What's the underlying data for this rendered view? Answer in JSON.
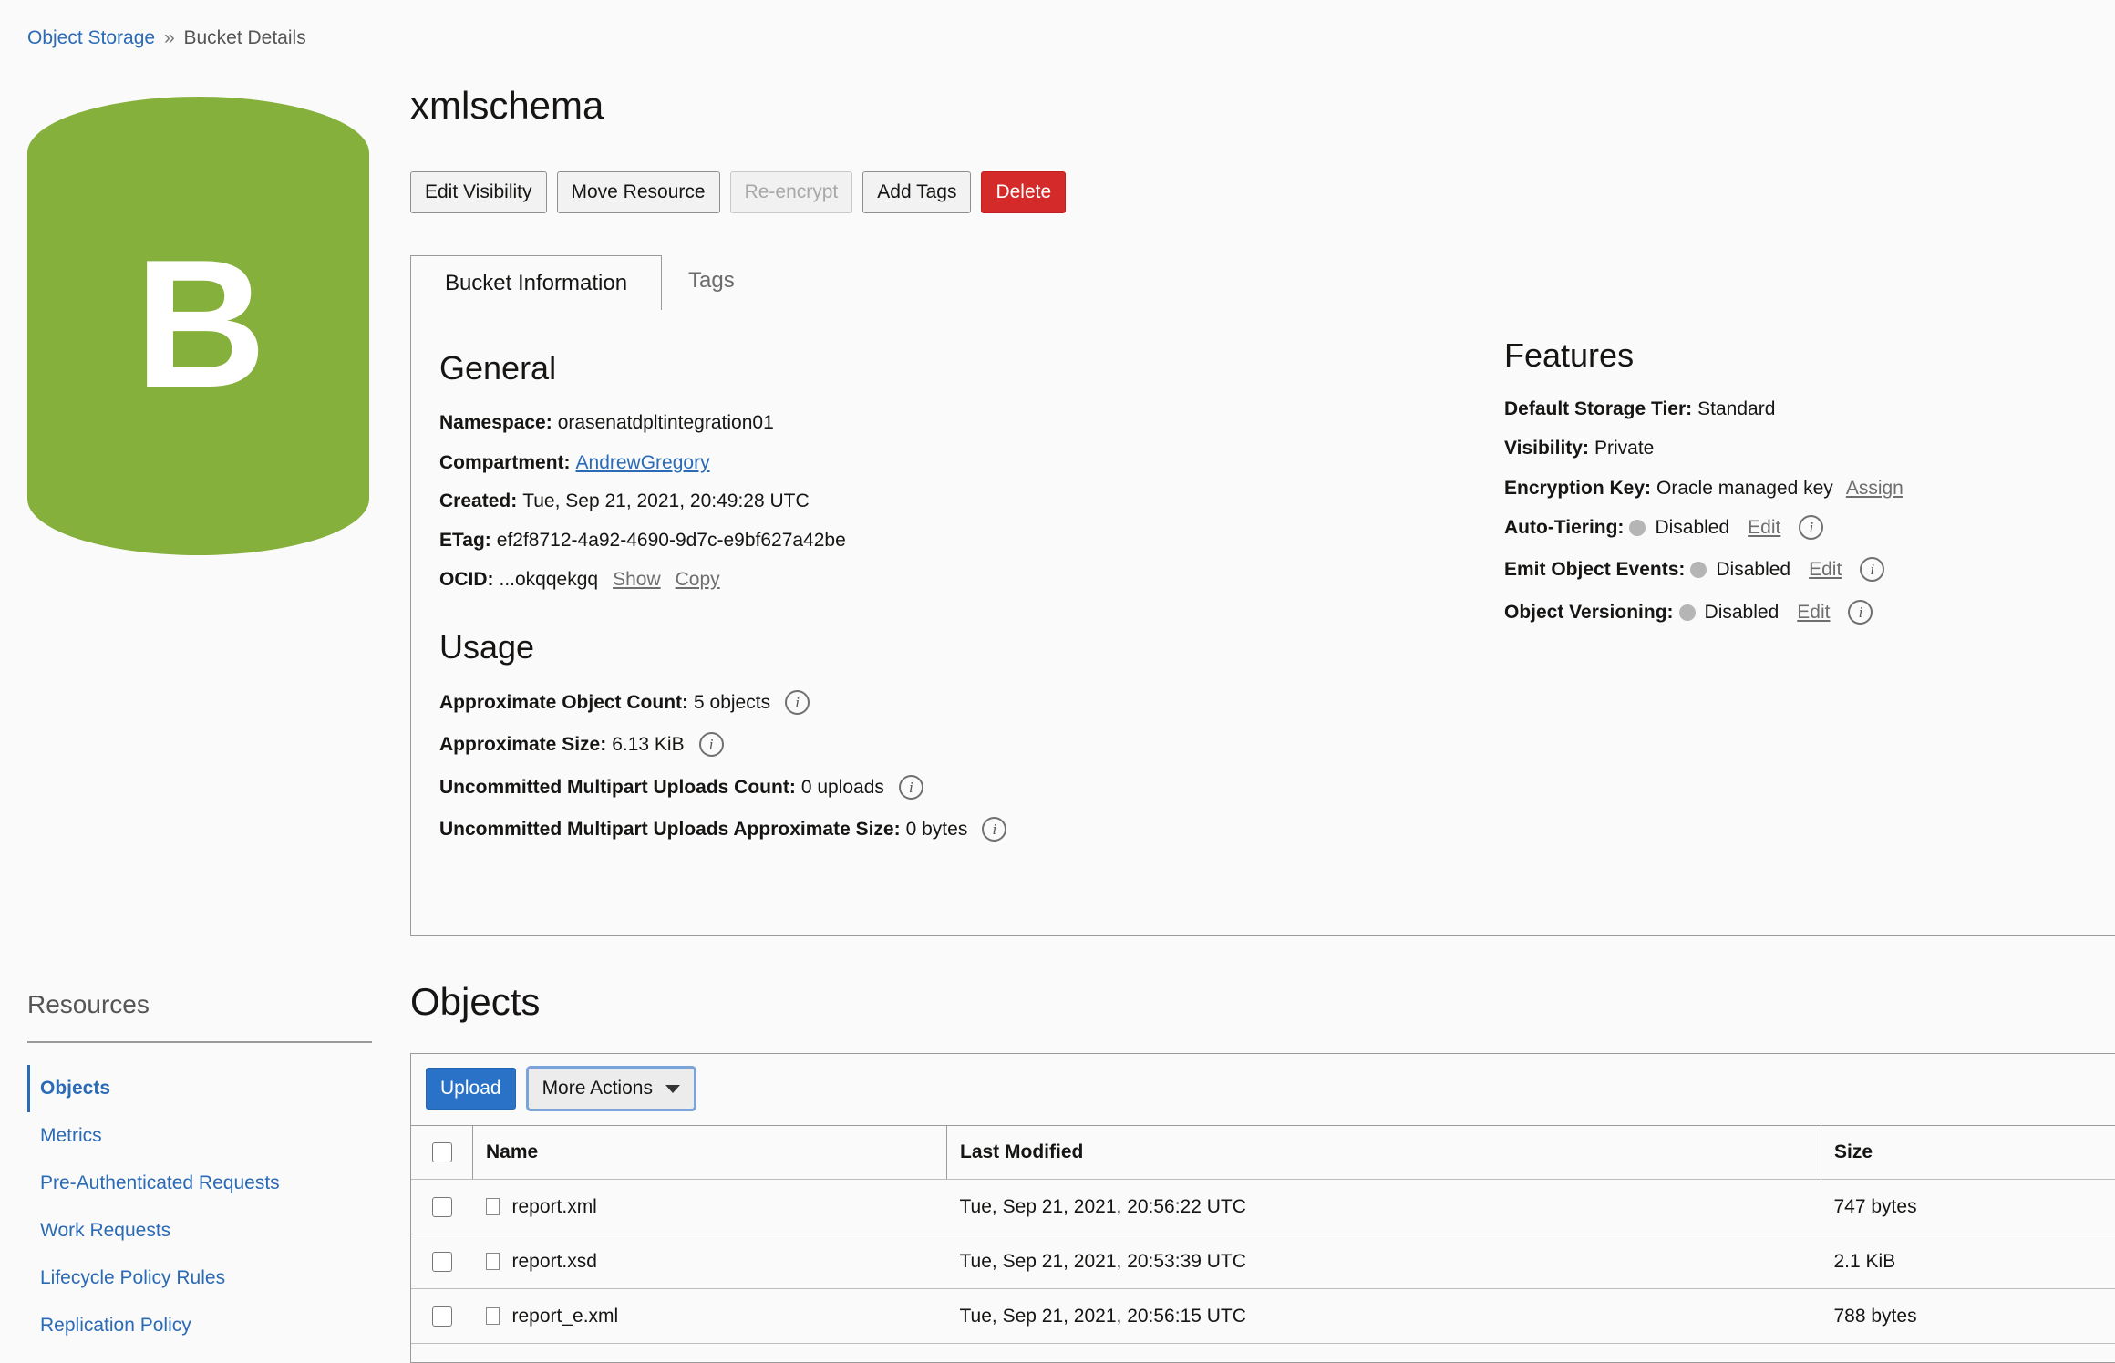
{
  "breadcrumb": {
    "root": "Object Storage",
    "separator": "»",
    "current": "Bucket Details"
  },
  "bucket_icon": {
    "letter": "B",
    "color": "#86b03c"
  },
  "title": "xmlschema",
  "actions": {
    "edit_visibility": "Edit Visibility",
    "move_resource": "Move Resource",
    "re_encrypt": "Re-encrypt",
    "add_tags": "Add Tags",
    "delete": "Delete"
  },
  "tabs": {
    "active": "Bucket Information",
    "inactive": "Tags"
  },
  "general": {
    "title": "General",
    "namespace_label": "Namespace:",
    "namespace": "orasenatdpltintegration01",
    "compartment_label": "Compartment:",
    "compartment": "AndrewGregory",
    "created_label": "Created:",
    "created": "Tue, Sep 21, 2021, 20:49:28 UTC",
    "etag_label": "ETag:",
    "etag": "ef2f8712-4a92-4690-9d7c-e9bf627a42be",
    "ocid_label": "OCID:",
    "ocid": "...okqqekgq",
    "show": "Show",
    "copy": "Copy"
  },
  "usage": {
    "title": "Usage",
    "object_count_label": "Approximate Object Count:",
    "object_count": "5 objects",
    "size_label": "Approximate Size:",
    "size": "6.13 KiB",
    "multipart_count_label": "Uncommitted Multipart Uploads Count:",
    "multipart_count": "0 uploads",
    "multipart_size_label": "Uncommitted Multipart Uploads Approximate Size:",
    "multipart_size": "0 bytes"
  },
  "features": {
    "title": "Features",
    "storage_tier_label": "Default Storage Tier:",
    "storage_tier": "Standard",
    "visibility_label": "Visibility:",
    "visibility": "Private",
    "encryption_label": "Encryption Key:",
    "encryption": "Oracle managed key",
    "assign": "Assign",
    "auto_tiering_label": "Auto-Tiering:",
    "auto_tiering": "Disabled",
    "emit_events_label": "Emit Object Events:",
    "emit_events": "Disabled",
    "versioning_label": "Object Versioning:",
    "versioning": "Disabled",
    "edit": "Edit"
  },
  "resources": {
    "title": "Resources",
    "items": [
      "Objects",
      "Metrics",
      "Pre-Authenticated Requests",
      "Work Requests",
      "Lifecycle Policy Rules",
      "Replication Policy"
    ]
  },
  "objects": {
    "title": "Objects",
    "upload": "Upload",
    "more_actions": "More Actions",
    "columns": {
      "name": "Name",
      "last_modified": "Last Modified",
      "size": "Size"
    },
    "rows": [
      {
        "name": "report.xml",
        "modified": "Tue, Sep 21, 2021, 20:56:22 UTC",
        "size": "747 bytes"
      },
      {
        "name": "report.xsd",
        "modified": "Tue, Sep 21, 2021, 20:53:39 UTC",
        "size": "2.1 KiB"
      },
      {
        "name": "report_e.xml",
        "modified": "Tue, Sep 21, 2021, 20:56:15 UTC",
        "size": "788 bytes"
      }
    ]
  }
}
